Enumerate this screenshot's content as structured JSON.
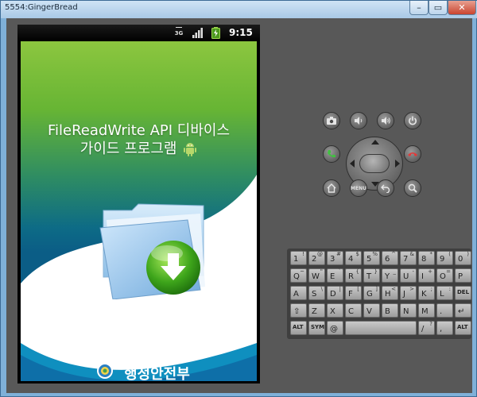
{
  "window": {
    "title": "5554:GingerBread",
    "minimize_label": "–",
    "maximize_label": "▭",
    "close_label": "✕"
  },
  "status_bar": {
    "network": "3G",
    "time": "9:15",
    "icons": [
      "signal-icon",
      "battery-charging-icon"
    ]
  },
  "app": {
    "title_line1": "FileReadWrite API 디바이스",
    "title_line2": "가이드 프로그램",
    "footer_text": "행정안전부",
    "icons": [
      "android-icon",
      "folder-download-icon",
      "ministry-logo-icon"
    ]
  },
  "hardware_buttons": {
    "row1": [
      "camera-icon",
      "volume-down-icon",
      "volume-up-icon",
      "power-icon"
    ],
    "row2": [
      "call-icon",
      "dpad",
      "end-call-icon"
    ],
    "row3": [
      "home-icon",
      "menu",
      "back-icon",
      "search-icon"
    ],
    "menu_label": "MENU"
  },
  "keyboard": {
    "rows": [
      [
        {
          "k": "1",
          "a": "!"
        },
        {
          "k": "2",
          "a": "@"
        },
        {
          "k": "3",
          "a": "#"
        },
        {
          "k": "4",
          "a": "$"
        },
        {
          "k": "5",
          "a": "%"
        },
        {
          "k": "6",
          "a": "^"
        },
        {
          "k": "7",
          "a": "&"
        },
        {
          "k": "8",
          "a": "*"
        },
        {
          "k": "9",
          "a": "("
        },
        {
          "k": "0",
          "a": ")"
        }
      ],
      [
        {
          "k": "Q",
          "a": "~"
        },
        {
          "k": "W",
          "a": "\""
        },
        {
          "k": "E",
          "a": "`"
        },
        {
          "k": "R",
          "a": "{"
        },
        {
          "k": "T",
          "a": "}"
        },
        {
          "k": "Y",
          "a": "_"
        },
        {
          "k": "U",
          "a": "-"
        },
        {
          "k": "I",
          "a": "+"
        },
        {
          "k": "O",
          "a": "="
        },
        {
          "k": "P",
          "a": ""
        }
      ],
      [
        {
          "k": "A",
          "a": ""
        },
        {
          "k": "S",
          "a": "\\"
        },
        {
          "k": "D",
          "a": "|"
        },
        {
          "k": "F",
          "a": "["
        },
        {
          "k": "G",
          "a": "]"
        },
        {
          "k": "H",
          "a": "<"
        },
        {
          "k": "J",
          "a": ">"
        },
        {
          "k": "K",
          "a": ";"
        },
        {
          "k": "L",
          "a": ":"
        },
        {
          "k": "DEL",
          "a": ""
        }
      ],
      [
        {
          "k": "⇧",
          "a": ""
        },
        {
          "k": "Z",
          "a": ""
        },
        {
          "k": "X",
          "a": ""
        },
        {
          "k": "C",
          "a": ""
        },
        {
          "k": "V",
          "a": ""
        },
        {
          "k": "B",
          "a": ""
        },
        {
          "k": "N",
          "a": ""
        },
        {
          "k": "M",
          "a": ""
        },
        {
          "k": ".",
          "a": ""
        },
        {
          "k": "↵",
          "a": ""
        }
      ],
      [
        {
          "k": "ALT",
          "a": ""
        },
        {
          "k": "SYM",
          "a": ""
        },
        {
          "k": "@",
          "a": ""
        },
        {
          "k": "",
          "a": ""
        },
        {
          "k": "/",
          "a": "?"
        },
        {
          "k": ",",
          "a": ""
        },
        {
          "k": "ALT",
          "a": ""
        }
      ]
    ]
  }
}
